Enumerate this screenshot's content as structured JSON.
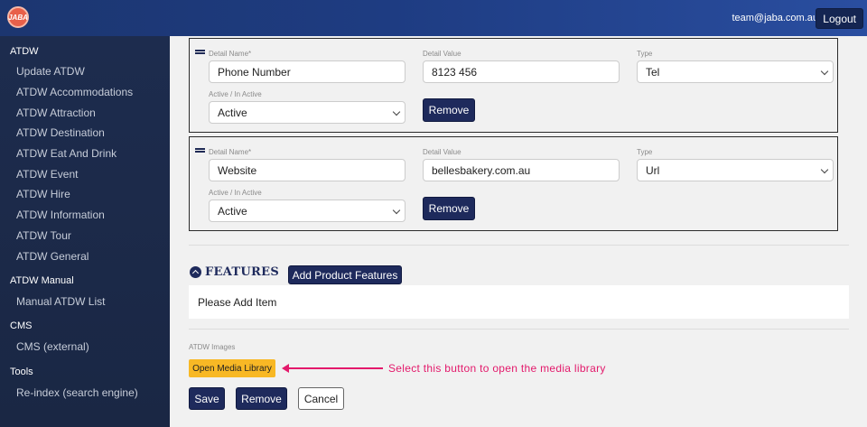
{
  "header": {
    "logo_text": "JABA",
    "user_email": "team@jaba.com.au",
    "logout_label": "Logout"
  },
  "sidebar": {
    "sections": [
      {
        "title": "ATDW",
        "items": [
          "Update ATDW",
          "ATDW Accommodations",
          "ATDW Attraction",
          "ATDW Destination",
          "ATDW Eat And Drink",
          "ATDW Event",
          "ATDW Hire",
          "ATDW Information",
          "ATDW Tour",
          "ATDW General"
        ]
      },
      {
        "title": "ATDW Manual",
        "items": [
          "Manual ATDW List"
        ]
      },
      {
        "title": "CMS",
        "items": [
          "CMS (external)"
        ]
      },
      {
        "title": "Tools",
        "items": [
          "Re-index (search engine)"
        ]
      }
    ]
  },
  "details": [
    {
      "name_label": "Detail Name*",
      "name_value": "Phone Number",
      "value_label": "Detail Value",
      "value_value": "8123 456",
      "type_label": "Type",
      "type_value": "Tel",
      "active_label": "Active / In Active",
      "active_value": "Active",
      "remove_label": "Remove"
    },
    {
      "name_label": "Detail Name*",
      "name_value": "Website",
      "value_label": "Detail Value",
      "value_value": "bellesbakery.com.au",
      "type_label": "Type",
      "type_value": "Url",
      "active_label": "Active / In Active",
      "active_value": "Active",
      "remove_label": "Remove"
    }
  ],
  "features": {
    "title": "FEATURES",
    "add_button": "Add Product Features",
    "empty_text": "Please Add Item"
  },
  "images": {
    "label": "ATDW Images",
    "open_media_label": "Open Media Library",
    "annotation": "Select this button to open the media library"
  },
  "actions": {
    "save": "Save",
    "remove": "Remove",
    "cancel": "Cancel"
  },
  "colors": {
    "navy": "#1e2a5c",
    "accent_yellow": "#f8b825",
    "annotation_pink": "#e3196b"
  }
}
